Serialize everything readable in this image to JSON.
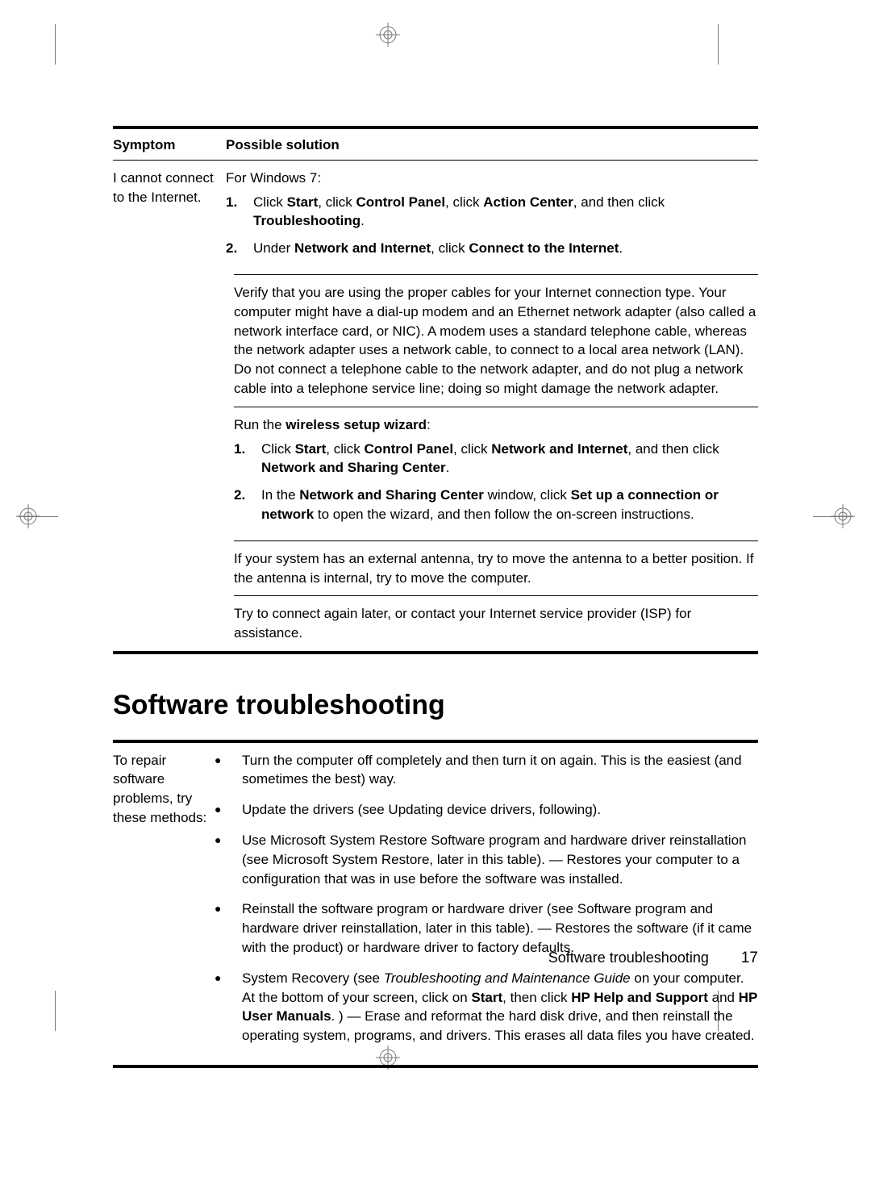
{
  "table1": {
    "headers": {
      "symptom": "Symptom",
      "solution": "Possible solution"
    },
    "symptom": "I cannot connect to the Internet.",
    "sol1": {
      "intro": "For Windows 7:",
      "steps": [
        {
          "n": "1.",
          "pre": "Click ",
          "b1": "Start",
          "mid1": ", click ",
          "b2": "Control Panel",
          "mid2": ", click ",
          "b3": "Action Center",
          "mid3": ", and then click ",
          "b4": "Troubleshooting",
          "post": "."
        },
        {
          "n": "2.",
          "pre": "Under ",
          "b1": "Network and Internet",
          "mid1": ", click ",
          "b2": "Connect to the Internet",
          "post": "."
        }
      ]
    },
    "sol2": "Verify that you are using the proper cables for your Internet connection type. Your computer might have a dial-up modem and an Ethernet network adapter (also called a network interface card, or NIC). A modem uses a standard telephone cable, whereas the network adapter uses a network cable, to connect to a local area network (LAN). Do not connect a telephone cable to the network adapter, and do not plug a network cable into a telephone service line; doing so might damage the network adapter.",
    "sol3": {
      "intro_pre": "Run the ",
      "intro_b": "wireless setup wizard",
      "intro_post": ":",
      "steps": [
        {
          "n": "1.",
          "pre": "Click ",
          "b1": "Start",
          "mid1": ", click ",
          "b2": "Control Panel",
          "mid2": ", click ",
          "b3": "Network and Internet",
          "mid3": ", and then click ",
          "b4": "Network and Sharing Center",
          "post": "."
        },
        {
          "n": "2.",
          "pre": "In the ",
          "b1": "Network and Sharing Center",
          "mid1": " window, click ",
          "b2": "Set up a connection or network",
          "post2": " to open the wizard, and then follow the on-screen instructions."
        }
      ]
    },
    "sol4": "If your system has an external antenna, try to move the antenna to a better position. If the antenna is internal, try to move the computer.",
    "sol5": "Try to connect again later, or contact your Internet service provider (ISP) for assistance."
  },
  "section_heading": "Software troubleshooting",
  "table2": {
    "left": "To repair software problems, try these methods:",
    "items": [
      {
        "text": "Turn the computer off completely and then turn it on again. This is the easiest (and sometimes the best) way."
      },
      {
        "text": "Update the drivers (see Updating device drivers, following)."
      },
      {
        "text": "Use Microsoft System Restore Software program and hardware driver reinstallation (see Microsoft System Restore, later in this table). — Restores your computer to a configuration that was in use before the software was installed."
      },
      {
        "text": "Reinstall the software program or hardware driver (see Software program and hardware driver reinstallation, later in this table). — Restores the software (if it came with the product) or hardware driver to factory defaults."
      },
      {
        "pre": "System Recovery (see ",
        "i1": "Troubleshooting and Maintenance Guide",
        "mid1": " on your computer. At the bottom of your screen, click on ",
        "b1": "Start",
        "mid2": ", then click ",
        "b2": "HP Help and Support",
        "mid3": " and ",
        "b3": "HP User Manuals",
        "post": ". ) — Erase and reformat the hard disk drive, and then reinstall the operating system, programs, and drivers. This erases all data files you have created."
      }
    ]
  },
  "footer": {
    "label": "Software troubleshooting",
    "page": "17"
  }
}
